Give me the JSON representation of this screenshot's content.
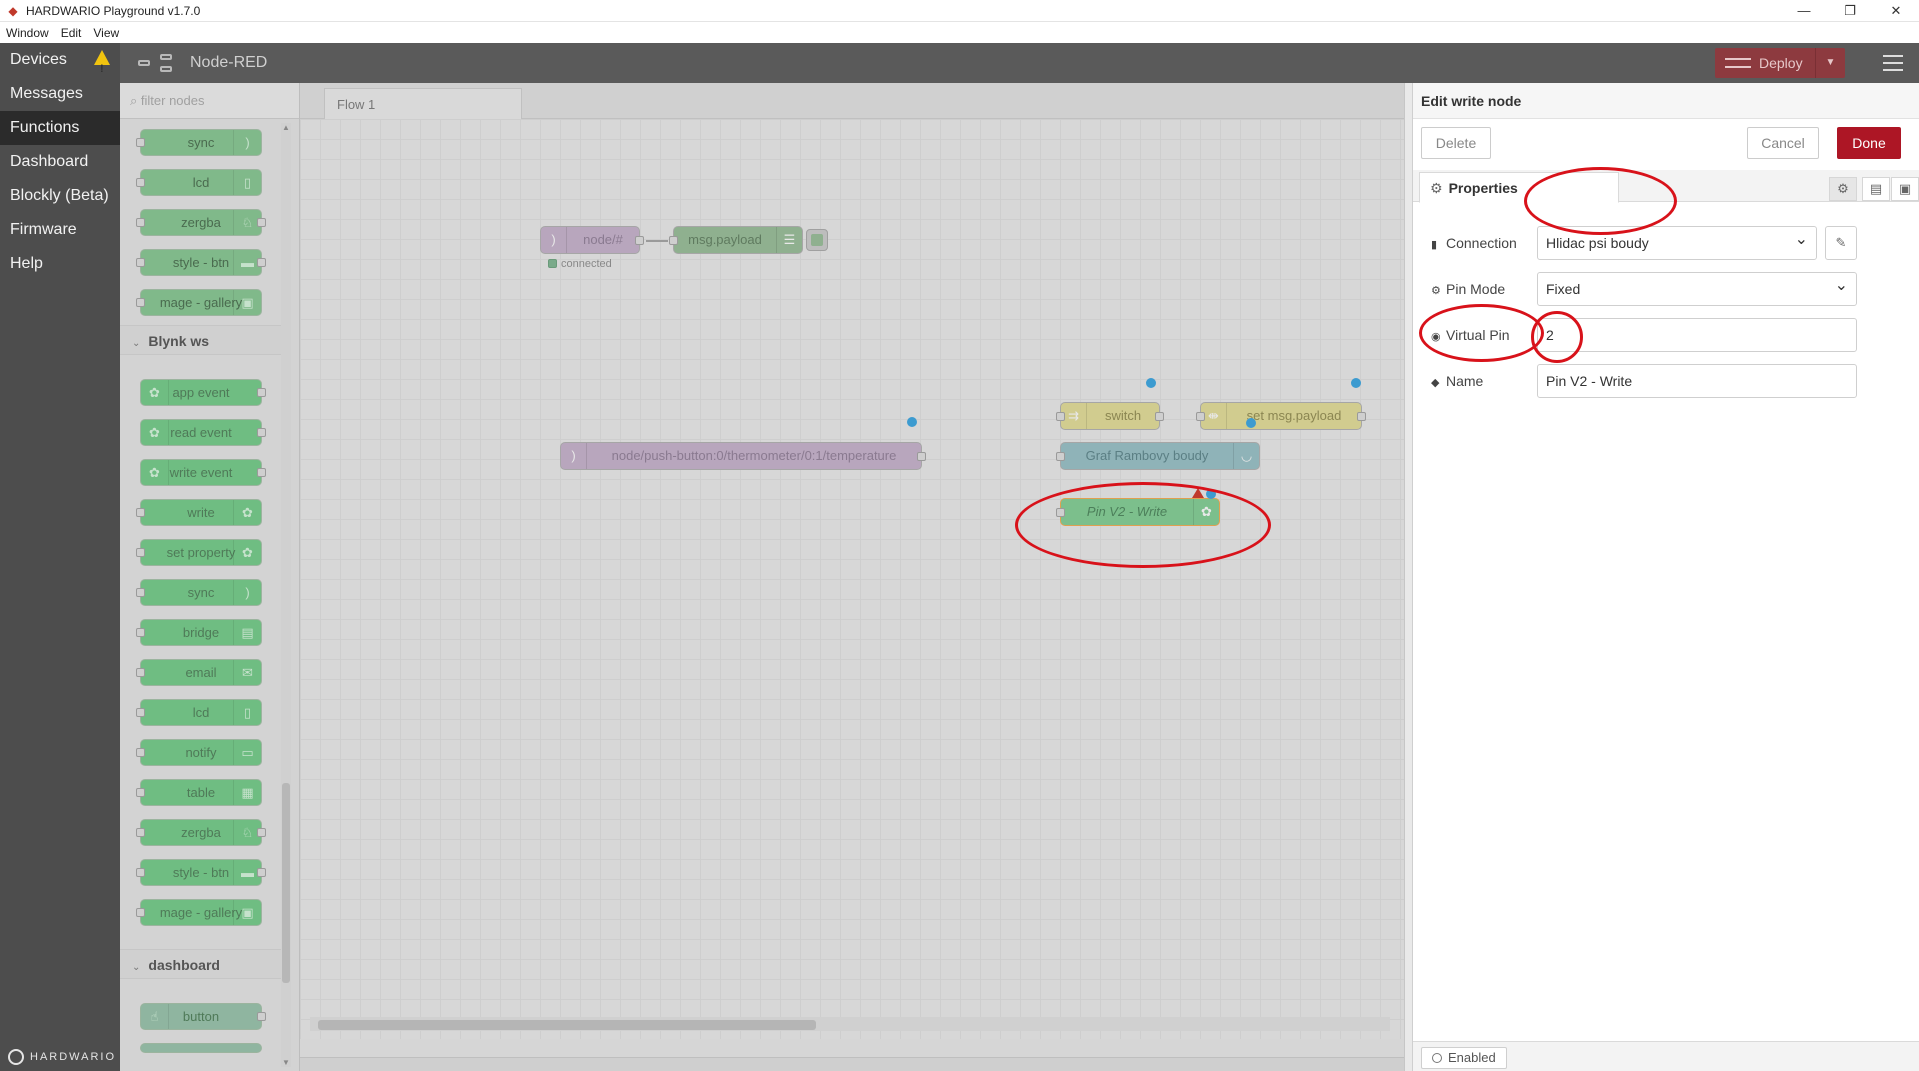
{
  "window": {
    "title": "HARDWARIO Playground v1.7.0",
    "controls": [
      "—",
      "❐",
      "✕"
    ]
  },
  "menubar": [
    "Window",
    "Edit",
    "View"
  ],
  "appnav": {
    "items": [
      {
        "label": "Devices",
        "warning": true
      },
      {
        "label": "Messages"
      },
      {
        "label": "Functions",
        "active": true
      },
      {
        "label": "Dashboard"
      },
      {
        "label": "Blockly (Beta)"
      },
      {
        "label": "Firmware"
      },
      {
        "label": "Help"
      }
    ],
    "brand": "HARDWARIO"
  },
  "nodered": {
    "title": "Node-RED",
    "deploy_label": "Deploy"
  },
  "palette": {
    "filter_placeholder": "filter nodes",
    "top_nodes": [
      "sync",
      "lcd",
      "zergba",
      "style - btn",
      "mage - gallery"
    ],
    "categories": {
      "blynk": "Blynk ws",
      "dashboard": "dashboard"
    },
    "blynk_nodes": [
      "app event",
      "read event",
      "write event",
      "write",
      "set property",
      "sync",
      "bridge",
      "email",
      "lcd",
      "notify",
      "table",
      "zergba",
      "style - btn",
      "mage - gallery"
    ],
    "dashboard_nodes": [
      "button"
    ]
  },
  "workspace": {
    "tab_label": "Flow 1",
    "nodes": {
      "mqtt_in": "node/#",
      "mqtt_status": "connected",
      "debug": "msg.payload",
      "switch": "switch",
      "change": "set msg.payload",
      "mqtt_temp": "node/push-button:0/thermometer/0:1/temperature",
      "gauge": "Graf Rambovy boudy",
      "write": "Pin V2 - Write"
    }
  },
  "editor": {
    "title": "Edit write node",
    "delete_label": "Delete",
    "cancel_label": "Cancel",
    "done_label": "Done",
    "tab_label": "Properties",
    "fields": {
      "connection": {
        "label": "Connection",
        "value": "Hlidac psi boudy"
      },
      "pin_mode": {
        "label": "Pin Mode",
        "value": "Fixed"
      },
      "virtual_pin": {
        "label": "Virtual Pin",
        "value": "2"
      },
      "name": {
        "label": "Name",
        "value": "Pin V2 - Write"
      }
    },
    "enabled_label": "Enabled"
  },
  "colors": {
    "accent_red": "#ad1625",
    "annotation_red": "#d8121a",
    "blynk_green": "#6fbd82"
  }
}
